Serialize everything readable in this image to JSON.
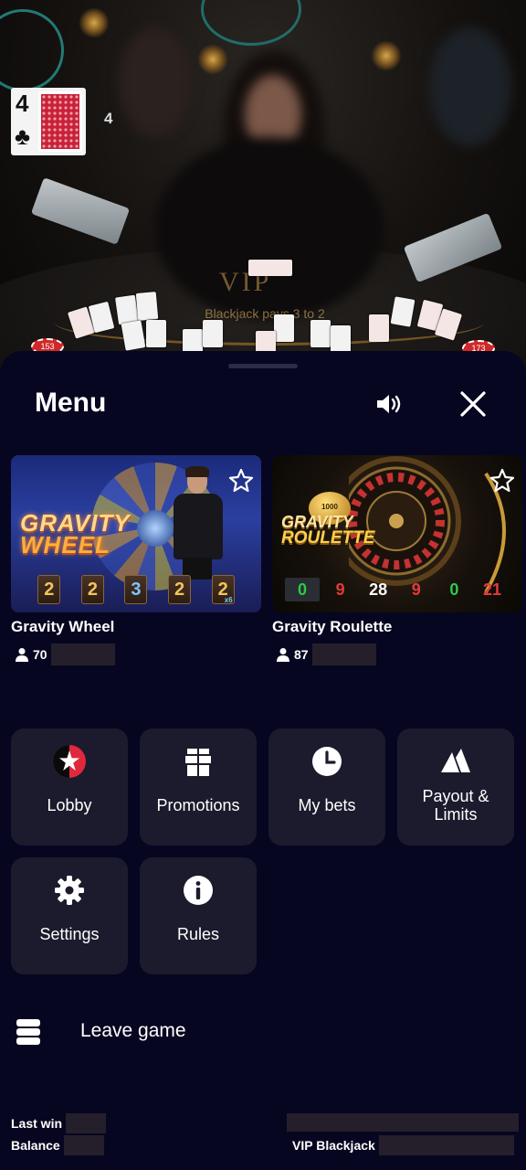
{
  "video": {
    "hand_card_rank": "4",
    "hand_card_suit": "♣",
    "hand_total": "4",
    "table_brand": "VIP",
    "table_text": "Blackjack pays 3 to 2",
    "chip_left": "153",
    "chip_right": "173"
  },
  "menu": {
    "title": "Menu",
    "icons": {
      "sound": "speaker-icon",
      "close": "close-icon"
    }
  },
  "games": [
    {
      "name": "Gravity Wheel",
      "logo_line1": "GRAVITY",
      "logo_line2": "WHEEL",
      "players": "70",
      "results": [
        "2",
        "2",
        "3",
        "2",
        "2"
      ],
      "last_multiplier": "x6"
    },
    {
      "name": "Gravity Roulette",
      "logo_line1": "GRAVITY",
      "logo_line2": "ROULETTE",
      "ball_label": "1000",
      "players": "87",
      "results": [
        {
          "value": "0",
          "color": "green"
        },
        {
          "value": "9",
          "color": "red"
        },
        {
          "value": "28",
          "color": "white"
        },
        {
          "value": "9",
          "color": "red"
        },
        {
          "value": "0",
          "color": "green"
        },
        {
          "value": "21",
          "color": "red"
        }
      ]
    }
  ],
  "tiles": [
    {
      "label": "Lobby",
      "icon": "lobby-star-icon"
    },
    {
      "label": "Promotions",
      "icon": "gift-icon"
    },
    {
      "label": "My bets",
      "icon": "clock-icon"
    },
    {
      "label_line1": "Payout &",
      "label_line2": "Limits",
      "icon": "payout-limits-icon"
    },
    {
      "label": "Settings",
      "icon": "gear-icon"
    },
    {
      "label": "Rules",
      "icon": "info-icon"
    }
  ],
  "leave": {
    "label": "Leave game",
    "icon": "exit-stack-icon"
  },
  "footer": {
    "last_win_label": "Last win",
    "balance_label": "Balance",
    "table_name": "VIP Blackjack"
  },
  "colors": {
    "sheet_bg": "#070621",
    "tile_bg": "#1c1b2d",
    "accent_red": "#e0283c"
  }
}
